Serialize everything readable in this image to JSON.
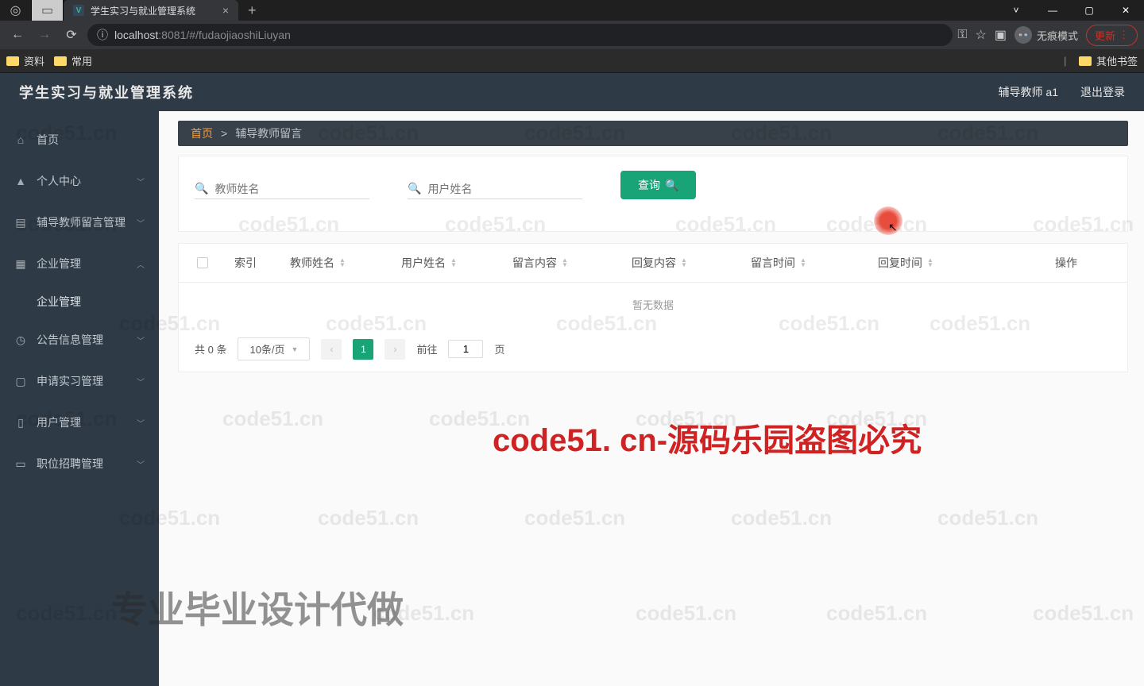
{
  "browser": {
    "tab_title": "学生实习与就业管理系统",
    "url_host": "localhost",
    "url_port": ":8081",
    "url_path": "/#/fudaojiaoshiLiuyan",
    "incognito_label": "无痕模式",
    "update_label": "更新"
  },
  "bookmarks": {
    "b1": "资料",
    "b2": "常用",
    "other": "其他书签"
  },
  "header": {
    "title": "学生实习与就业管理系统",
    "user": "辅导教师 a1",
    "logout": "退出登录"
  },
  "sidebar": {
    "home": "首页",
    "personal": "个人中心",
    "msg_mgmt": "辅导教师留言管理",
    "ent_mgmt": "企业管理",
    "ent_sub": "企业管理",
    "notice": "公告信息管理",
    "apply": "申请实习管理",
    "user_mgmt": "用户管理",
    "job_mgmt": "职位招聘管理"
  },
  "crumb": {
    "home": "首页",
    "sep": ">",
    "current": "辅导教师留言"
  },
  "query": {
    "ph1": "教师姓名",
    "ph2": "用户姓名",
    "btn": "查询"
  },
  "table": {
    "cols": {
      "index": "索引",
      "teacher": "教师姓名",
      "user": "用户姓名",
      "content": "留言内容",
      "reply": "回复内容",
      "time1": "留言时间",
      "time2": "回复时间",
      "ops": "操作"
    },
    "empty": "暂无数据"
  },
  "pager": {
    "total": "共 0 条",
    "size": "10条/页",
    "current": "1",
    "goto_pre": "前往",
    "goto_val": "1",
    "goto_suf": "页"
  },
  "overlay": {
    "red": "code51. cn-源码乐园盗图必究",
    "gray": "专业毕业设计代做",
    "wm": "code51.cn"
  }
}
